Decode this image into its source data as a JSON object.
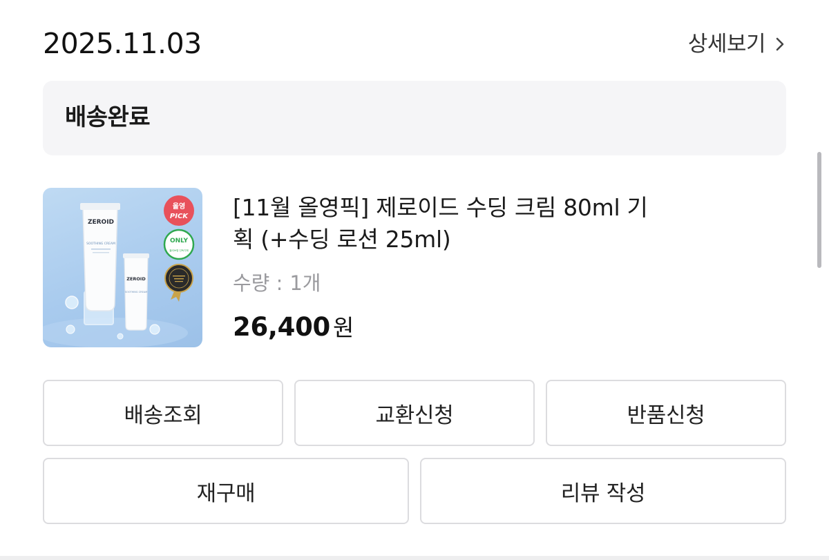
{
  "order": {
    "date": "2025.11.03",
    "detail_link_label": "상세보기",
    "status": "배송완료"
  },
  "product": {
    "name": "[11월 올영픽] 제로이드 수딩 크림 80ml 기\n획 (+수딩 로션 25ml)",
    "quantity_label": "수량 :",
    "quantity_value": "1개",
    "price": "26,400",
    "price_unit": "원",
    "image": {
      "brand": "ZEROID",
      "tube_text": "SOOTHING CREAM",
      "badge_top": "올영",
      "badge_pick": "PICK",
      "badge_only": "ONLY",
      "badge_only_sub": "올리브영 단독기획",
      "colors": {
        "background": "#a9cbee",
        "pick_badge": "#e8515b",
        "only_badge": "#2fa84f",
        "award_badge": "#2a2a2a"
      }
    }
  },
  "actions": {
    "track": "배송조회",
    "exchange": "교환신청",
    "return": "반품신청",
    "rebuy": "재구매",
    "review": "리뷰 작성"
  }
}
